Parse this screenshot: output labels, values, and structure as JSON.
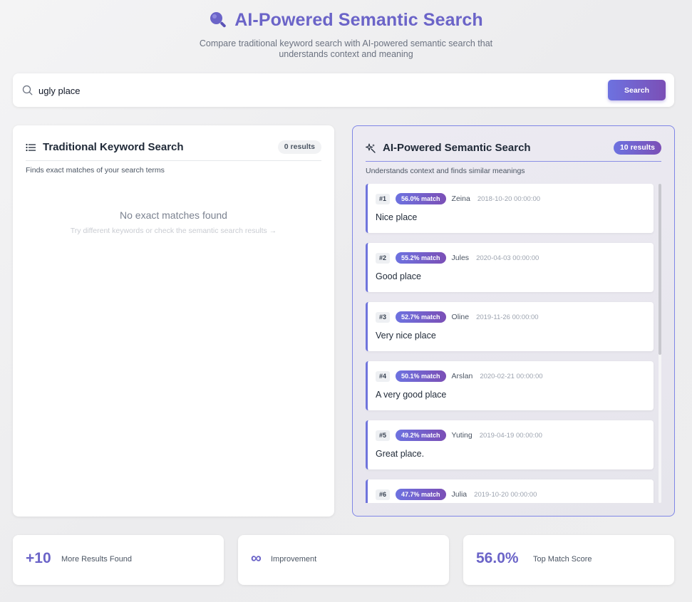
{
  "header": {
    "title": "AI-Powered Semantic Search",
    "subtitle": "Compare traditional keyword search with AI-powered semantic search that understands context and meaning"
  },
  "search": {
    "value": "ugly place",
    "button_label": "Search"
  },
  "keyword_panel": {
    "title": "Traditional Keyword Search",
    "count": "0 results",
    "description": "Finds exact matches of your search terms",
    "empty_title": "No exact matches found",
    "empty_hint": "Try different keywords or check the semantic search results →"
  },
  "semantic_panel": {
    "title": "AI-Powered Semantic Search",
    "count": "10 results",
    "description": "Understands context and finds similar meanings",
    "results": [
      {
        "rank": "#1",
        "match": "56.0% match",
        "author": "Zeina",
        "date": "2018-10-20 00:00:00",
        "text": "Nice place"
      },
      {
        "rank": "#2",
        "match": "55.2% match",
        "author": "Jules",
        "date": "2020-04-03 00:00:00",
        "text": "Good place"
      },
      {
        "rank": "#3",
        "match": "52.7% match",
        "author": "Oline",
        "date": "2019-11-26 00:00:00",
        "text": "Very nice place"
      },
      {
        "rank": "#4",
        "match": "50.1% match",
        "author": "Arslan",
        "date": "2020-02-21 00:00:00",
        "text": "A very good place"
      },
      {
        "rank": "#5",
        "match": "49.2% match",
        "author": "Yuting",
        "date": "2019-04-19 00:00:00",
        "text": "Great place."
      },
      {
        "rank": "#6",
        "match": "47.7% match",
        "author": "Julia",
        "date": "2019-10-20 00:00:00",
        "text": ""
      }
    ]
  },
  "stats": [
    {
      "value": "+10",
      "label": "More Results Found"
    },
    {
      "value": "∞",
      "label": "Improvement"
    },
    {
      "value": "56.0%",
      "label": "Top Match Score"
    }
  ],
  "colors": {
    "accent": "#6b64c8",
    "gradient_start": "#6d72e0",
    "gradient_end": "#7b4fb6",
    "panel_border": "#7f86e6"
  },
  "icons": {
    "title": "magnifier-icon",
    "search": "search-icon",
    "keyword_panel": "list-icon",
    "semantic_panel": "sparkles-icon"
  }
}
